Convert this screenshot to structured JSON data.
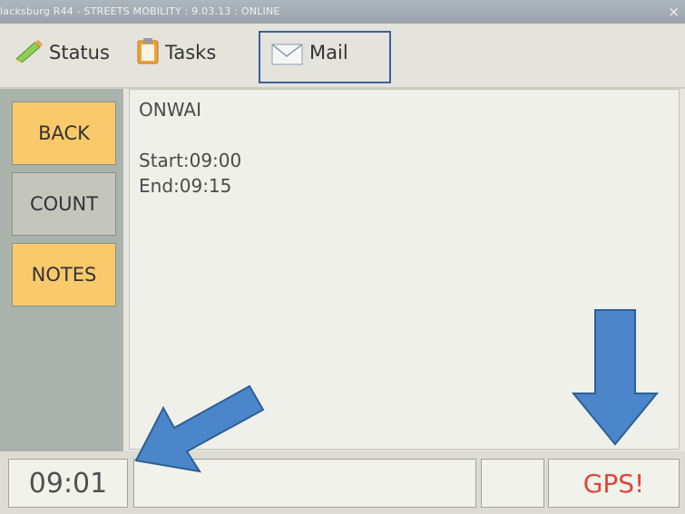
{
  "window": {
    "title": "lacksburg R44 - STREETS MOBILITY : 9.03.13 : ONLINE",
    "close_glyph": "×"
  },
  "tabs": [
    {
      "label": "Status",
      "icon": "pencil-icon"
    },
    {
      "label": "Tasks",
      "icon": "clipboard-icon"
    },
    {
      "label": "Mail",
      "icon": "envelope-icon",
      "selected": true
    }
  ],
  "sidebar": {
    "buttons": [
      {
        "label": "BACK"
      },
      {
        "label": "COUNT"
      },
      {
        "label": "NOTES"
      }
    ]
  },
  "message": {
    "line1": "ONWAI",
    "start": "Start:09:00",
    "end": "End:09:15"
  },
  "statusbar": {
    "time": "09:01",
    "gps": "GPS!"
  },
  "colors": {
    "accent_button": "#f9c96b",
    "gps_alert": "#e0463c",
    "annotation_arrow": "#4a86c9"
  }
}
